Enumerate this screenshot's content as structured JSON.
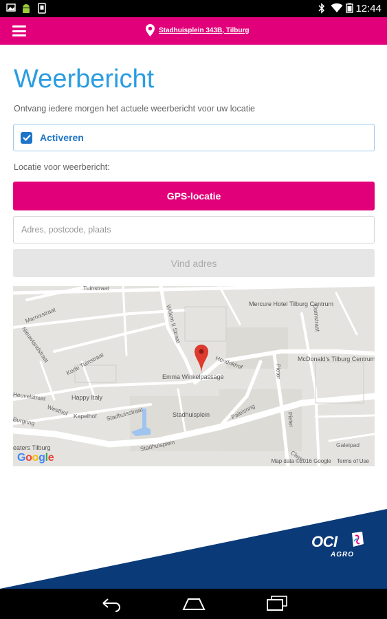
{
  "status_bar": {
    "time": "12:44"
  },
  "header": {
    "location": "Stadhuisplein 343B, Tilburg"
  },
  "main": {
    "title": "Weerbericht",
    "subtitle": "Ontvang iedere morgen het actuele weerbericht voor uw locatie",
    "activate_label": "Activeren",
    "activate_checked": true,
    "location_label": "Locatie voor weerbericht:",
    "gps_button": "GPS-locatie",
    "address_placeholder": "Adres, postcode, plaats",
    "find_button": "Vind adres"
  },
  "map": {
    "places": {
      "mercure": "Mercure Hotel Tilburg Centrum",
      "mcdonalds": "McDonald's Tilburg Centrum",
      "emma": "Emma Winkelpassage",
      "happy_italy": "Happy Italy",
      "stadhuisplein_label": "Stadhuisplein",
      "theaters": "eaters Tilburg"
    },
    "streets": {
      "tuinstraat": "Tuinstraat",
      "marnixstraat": "Marnixstraat",
      "nieuwlandstraat": "Nieuwlandstraat",
      "korte_tuinstraat": "Korte Tuinstraat",
      "willem_ii": "Willem II Straat",
      "hendrikhof": "Hendrikhof",
      "damstraat": "Damstraat",
      "pieter": "Pieter",
      "heuvelstraat": "Heuvelstraat",
      "westhof": "Westhof",
      "kapelhof": "Kapelhof",
      "stadhuisstraat": "Stadhuisstraat",
      "burgring": "Burgring",
      "stadhuisplein_street": "Stadhuisplein",
      "paleisring": "Paleisring",
      "pieter_2": "Pieter",
      "galeipad": "Galeipad",
      "clerc": "Clerc"
    },
    "logo": "Google",
    "attribution": "Map data ©2016 Google",
    "terms": "Terms of Use"
  },
  "brand": {
    "name": "OCI",
    "sub": "AGRO"
  },
  "colors": {
    "accent": "#e2007a",
    "title_blue": "#2a9de0",
    "brand_navy": "#0a3a78"
  }
}
